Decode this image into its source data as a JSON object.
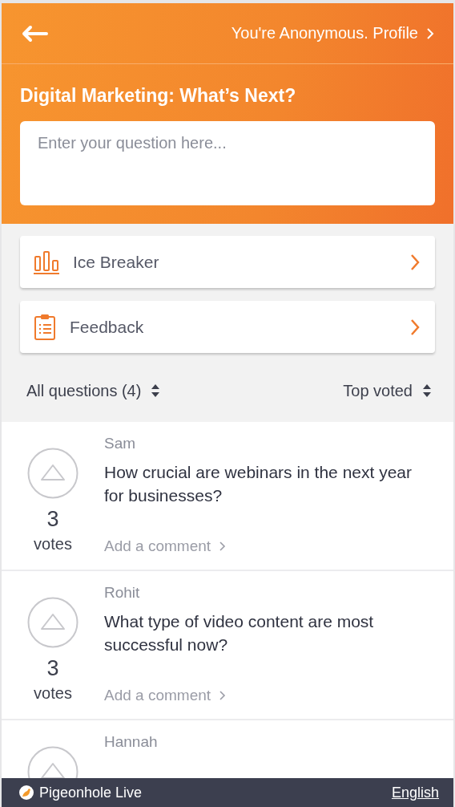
{
  "header": {
    "profile_link": "You're Anonymous. Profile"
  },
  "event": {
    "title": "Digital Marketing: What’s Next?",
    "question_input": {
      "placeholder": "Enter your question here..."
    }
  },
  "activities": [
    {
      "kind": "poll",
      "label": "Ice Breaker"
    },
    {
      "kind": "survey",
      "label": "Feedback"
    }
  ],
  "filters": {
    "scope": "All questions (4)",
    "sort": "Top voted"
  },
  "questions": [
    {
      "author": "Sam",
      "text": "How crucial are webinars in the next year for businesses?",
      "votes": "3",
      "votes_label": "votes",
      "comment_link": "Add a comment"
    },
    {
      "author": "Rohit",
      "text": "What type of video content are most successful now?",
      "votes": "3",
      "votes_label": "votes",
      "comment_link": "Add a comment"
    },
    {
      "author": "Hannah"
    }
  ],
  "footer": {
    "brand": "Pigeonhole Live",
    "language": "English"
  }
}
